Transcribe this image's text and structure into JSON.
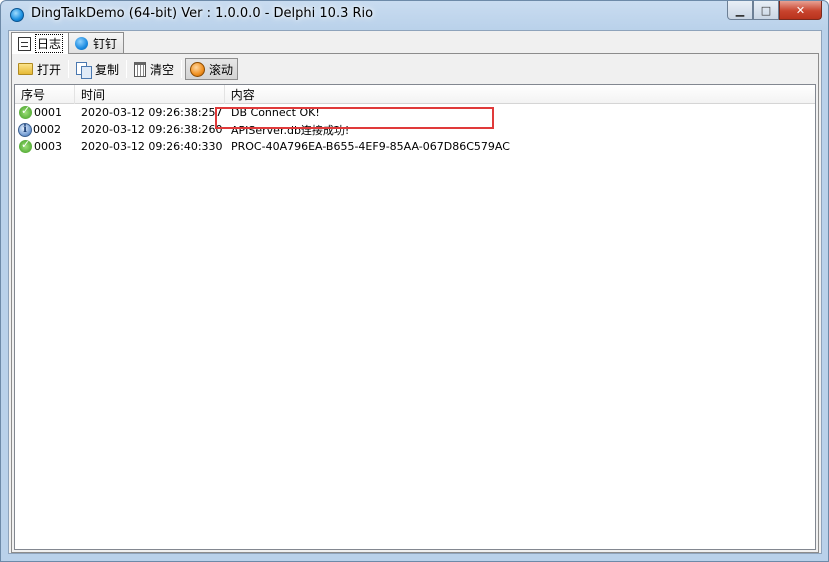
{
  "window": {
    "title": "DingTalkDemo (64-bit) Ver : 1.0.0.0 - Delphi 10.3 Rio",
    "controls": {
      "minimize": "▁",
      "maximize": "□",
      "close": "✕"
    }
  },
  "tabs": [
    {
      "label": "日志",
      "icon": "log-icon",
      "active": true
    },
    {
      "label": "钉钉",
      "icon": "dingtalk-icon",
      "active": false
    }
  ],
  "toolbar": {
    "open_label": "打开",
    "copy_label": "复制",
    "clear_label": "清空",
    "scroll_label": "滚动"
  },
  "log": {
    "columns": {
      "seq": "序号",
      "time": "时间",
      "content": "内容"
    },
    "rows": [
      {
        "seq": "0001",
        "time": "2020-03-12 09:26:38:257",
        "content": "DB Connect OK!",
        "icon": "success-icon"
      },
      {
        "seq": "0002",
        "time": "2020-03-12 09:26:38:260",
        "content": "APIServer.db连接成功!",
        "icon": "info-icon"
      },
      {
        "seq": "0003",
        "time": "2020-03-12 09:26:40:330",
        "content": "PROC-40A796EA-B655-4EF9-85AA-067D86C579AC",
        "icon": "success-icon"
      }
    ]
  },
  "colors": {
    "highlight": "#e03a3a",
    "accent": "#1a8fe0"
  }
}
